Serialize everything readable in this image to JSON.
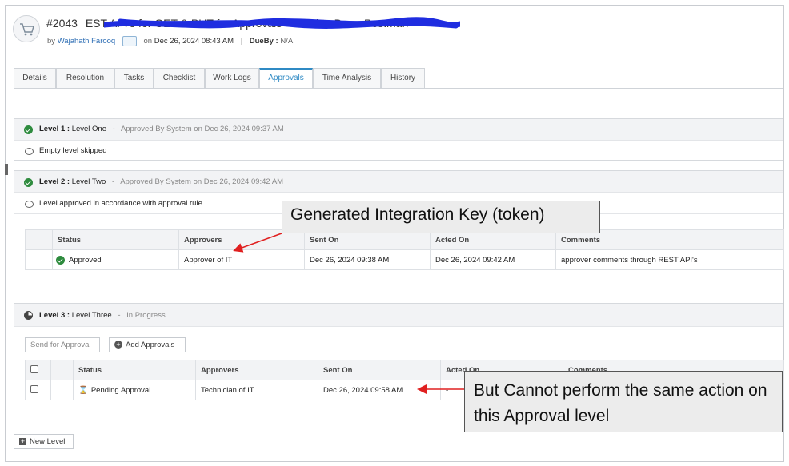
{
  "ticket": {
    "number": "#2043",
    "title": "EST API's for GET & PUT for Approvals - Need to Do ... Postman",
    "by_label": "by",
    "author": "Wajahath Farooq",
    "on_label": "on",
    "date": "Dec 26, 2024 08:43 AM",
    "separator": "|",
    "dueby_label": "DueBy :",
    "dueby_value": "N/A"
  },
  "tabs": [
    "Details",
    "Resolution",
    "Tasks",
    "Checklist",
    "Work Logs",
    "Approvals",
    "Time Analysis",
    "History"
  ],
  "active_tab": "Approvals",
  "levels": [
    {
      "level_label": "Level",
      "level_no": "1",
      "level_name": "Level One",
      "dash": "-",
      "status_text": "Approved By System on Dec 26, 2024 09:37 AM",
      "note": "Empty level skipped"
    },
    {
      "level_label": "Level",
      "level_no": "2",
      "level_name": "Level Two",
      "dash": "-",
      "status_text": "Approved By System on Dec 26, 2024 09:42 AM",
      "note": "Level approved in accordance with approval rule.",
      "table": {
        "headers": [
          "Status",
          "Approvers",
          "Sent On",
          "Acted On",
          "Comments"
        ],
        "rows": [
          [
            "Approved",
            "Approver of IT",
            "Dec 26, 2024 09:38 AM",
            "Dec 26, 2024 09:42 AM",
            "approver comments through REST API's"
          ]
        ]
      }
    },
    {
      "level_label": "Level",
      "level_no": "3",
      "level_name": "Level Three",
      "dash": "-",
      "status_text": "In Progress",
      "send_button": "Send for Approval",
      "add_button": "Add Approvals",
      "table": {
        "headers": [
          "Status",
          "Approvers",
          "Sent On",
          "Acted On",
          "Comments"
        ],
        "rows": [
          [
            "Pending Approval",
            "Technician of IT",
            "Dec 26, 2024 09:58 AM",
            "-",
            ""
          ]
        ]
      }
    }
  ],
  "new_level_button": "New Level",
  "annotations": {
    "callout1": "Generated Integration Key (token)",
    "callout2": "But Cannot perform the same action on this Approval level"
  },
  "colors": {
    "accent": "#2f8ac4",
    "approved": "#2e8b3e",
    "arrow": "#e02020",
    "scribble": "#1f2de0"
  }
}
